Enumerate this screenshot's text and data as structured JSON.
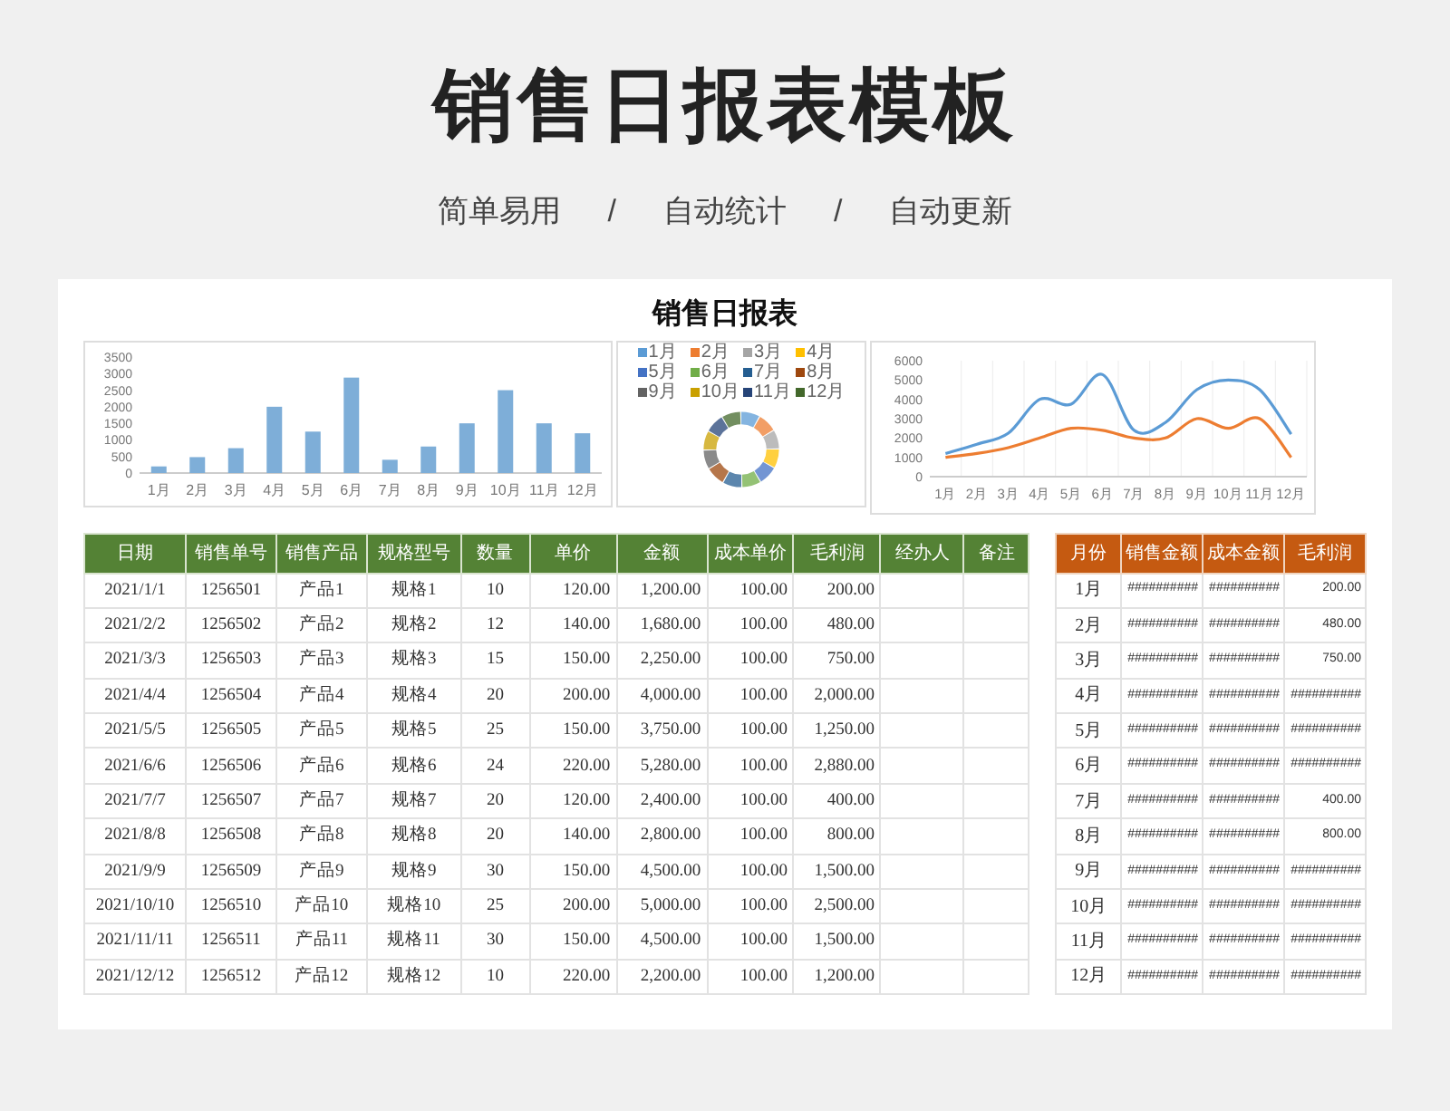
{
  "title": "销售日报表模板",
  "subtitle": [
    "简单易用",
    "/",
    "自动统计",
    "/",
    "自动更新"
  ],
  "sheet": {
    "title": "销售日报表",
    "bar_chart": {
      "chart_data": {
        "type": "bar",
        "categories": [
          "1月",
          "2月",
          "3月",
          "4月",
          "5月",
          "6月",
          "7月",
          "8月",
          "9月",
          "10月",
          "11月",
          "12月"
        ],
        "series": [
          {
            "color": "#7eaed8",
            "values": [
              200,
              480,
              750,
              2000,
              1250,
              2880,
              400,
              800,
              1500,
              2500,
              1500,
              1200
            ]
          }
        ],
        "ylim": [
          0,
          3500
        ],
        "yticks": [
          0,
          500,
          1000,
          1500,
          2000,
          2500,
          3000,
          3500
        ]
      }
    },
    "donut_legend": [
      {
        "label": "1月",
        "color": "#5b9bd5"
      },
      {
        "label": "2月",
        "color": "#ed7d31"
      },
      {
        "label": "3月",
        "color": "#a5a5a5"
      },
      {
        "label": "4月",
        "color": "#ffc000"
      },
      {
        "label": "5月",
        "color": "#4472c4"
      },
      {
        "label": "6月",
        "color": "#70ad47"
      },
      {
        "label": "7月",
        "color": "#255e91"
      },
      {
        "label": "8月",
        "color": "#9e480e"
      },
      {
        "label": "9月",
        "color": "#636363"
      },
      {
        "label": "10月",
        "color": "#c9a000"
      },
      {
        "label": "11月",
        "color": "#264478"
      },
      {
        "label": "12月",
        "color": "#43682b"
      }
    ],
    "line_chart": {
      "chart_data": {
        "type": "line",
        "categories": [
          "1月",
          "2月",
          "3月",
          "4月",
          "5月",
          "6月",
          "7月",
          "8月",
          "9月",
          "10月",
          "11月",
          "12月"
        ],
        "series": [
          {
            "color": "#5b9bd5",
            "values": [
              1200,
              1680,
              2250,
              4000,
              3750,
              5280,
              2400,
              2800,
              4500,
              5000,
              4500,
              2200
            ]
          },
          {
            "color": "#ed7d31",
            "values": [
              1000,
              1200,
              1500,
              2000,
              2500,
              2400,
              2000,
              2000,
              3000,
              2500,
              3000,
              1000
            ]
          }
        ],
        "ylim": [
          0,
          6000
        ],
        "yticks": [
          0,
          1000,
          2000,
          3000,
          4000,
          5000,
          6000
        ]
      }
    },
    "table": {
      "columns": [
        "日期",
        "销售单号",
        "销售产品",
        "规格型号",
        "数量",
        "单价",
        "金额",
        "成本单价",
        "毛利润",
        "经办人",
        "备注"
      ],
      "rows": [
        [
          "2021/1/1",
          "1256501",
          "产品1",
          "规格1",
          "10",
          "120.00",
          "1,200.00",
          "100.00",
          "200.00"
        ],
        [
          "2021/2/2",
          "1256502",
          "产品2",
          "规格2",
          "12",
          "140.00",
          "1,680.00",
          "100.00",
          "480.00"
        ],
        [
          "2021/3/3",
          "1256503",
          "产品3",
          "规格3",
          "15",
          "150.00",
          "2,250.00",
          "100.00",
          "750.00"
        ],
        [
          "2021/4/4",
          "1256504",
          "产品4",
          "规格4",
          "20",
          "200.00",
          "4,000.00",
          "100.00",
          "2,000.00"
        ],
        [
          "2021/5/5",
          "1256505",
          "产品5",
          "规格5",
          "25",
          "150.00",
          "3,750.00",
          "100.00",
          "1,250.00"
        ],
        [
          "2021/6/6",
          "1256506",
          "产品6",
          "规格6",
          "24",
          "220.00",
          "5,280.00",
          "100.00",
          "2,880.00"
        ],
        [
          "2021/7/7",
          "1256507",
          "产品7",
          "规格7",
          "20",
          "120.00",
          "2,400.00",
          "100.00",
          "400.00"
        ],
        [
          "2021/8/8",
          "1256508",
          "产品8",
          "规格8",
          "20",
          "140.00",
          "2,800.00",
          "100.00",
          "800.00"
        ],
        [
          "2021/9/9",
          "1256509",
          "产品9",
          "规格9",
          "30",
          "150.00",
          "4,500.00",
          "100.00",
          "1,500.00"
        ],
        [
          "2021/10/10",
          "1256510",
          "产品10",
          "规格10",
          "25",
          "200.00",
          "5,000.00",
          "100.00",
          "2,500.00"
        ],
        [
          "2021/11/11",
          "1256511",
          "产品11",
          "规格11",
          "30",
          "150.00",
          "4,500.00",
          "100.00",
          "1,500.00"
        ],
        [
          "2021/12/12",
          "1256512",
          "产品12",
          "规格12",
          "10",
          "220.00",
          "2,200.00",
          "100.00",
          "1,200.00"
        ]
      ]
    },
    "monthly": {
      "columns": [
        "月份",
        "销售金额",
        "成本金额",
        "毛利润"
      ],
      "rows": [
        [
          "1月",
          "##########",
          "##########",
          "200.00"
        ],
        [
          "2月",
          "##########",
          "##########",
          "480.00"
        ],
        [
          "3月",
          "##########",
          "##########",
          "750.00"
        ],
        [
          "4月",
          "##########",
          "##########",
          "##########"
        ],
        [
          "5月",
          "##########",
          "##########",
          "##########"
        ],
        [
          "6月",
          "##########",
          "##########",
          "##########"
        ],
        [
          "7月",
          "##########",
          "##########",
          "400.00"
        ],
        [
          "8月",
          "##########",
          "##########",
          "800.00"
        ],
        [
          "9月",
          "##########",
          "##########",
          "##########"
        ],
        [
          "10月",
          "##########",
          "##########",
          "##########"
        ],
        [
          "11月",
          "##########",
          "##########",
          "##########"
        ],
        [
          "12月",
          "##########",
          "##########",
          "##########"
        ]
      ]
    }
  }
}
